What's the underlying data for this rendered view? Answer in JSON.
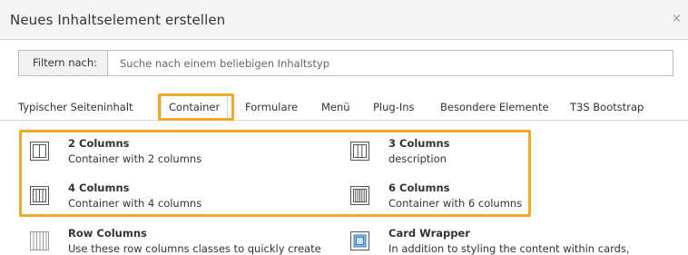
{
  "modal": {
    "title": "Neues Inhaltselement erstellen",
    "close": "×"
  },
  "filter": {
    "label": "Filtern nach:",
    "placeholder": "Suche nach einem beliebigen Inhaltstyp",
    "value": ""
  },
  "tabs": [
    {
      "label": "Typischer Seiteninhalt",
      "active": false
    },
    {
      "label": "Container",
      "active": true
    },
    {
      "label": "Formulare",
      "active": false
    },
    {
      "label": "Menü",
      "active": false
    },
    {
      "label": "Plug-Ins",
      "active": false
    },
    {
      "label": "Besondere Elemente",
      "active": false
    },
    {
      "label": "T3S Bootstrap",
      "active": false
    }
  ],
  "items": [
    {
      "title": "2 Columns",
      "description": "Container with 2 columns",
      "icon": "two-columns-icon"
    },
    {
      "title": "3 Columns",
      "description": "description",
      "icon": "three-columns-icon"
    },
    {
      "title": "4 Columns",
      "description": "Container with 4 columns",
      "icon": "four-columns-icon"
    },
    {
      "title": "6 Columns",
      "description": "Container with 6 columns",
      "icon": "six-columns-icon"
    },
    {
      "title": "Row Columns",
      "description": "Use these row columns classes to quickly create",
      "icon": "row-columns-icon"
    },
    {
      "title": "Card Wrapper",
      "description": "In addition to styling the content within cards,",
      "icon": "card-wrapper-icon"
    }
  ],
  "colors": {
    "highlight": "#f0a92a",
    "header_bg": "#f5f5f5",
    "icon_stroke": "#555555",
    "card_blue": "#3a7bbf"
  }
}
